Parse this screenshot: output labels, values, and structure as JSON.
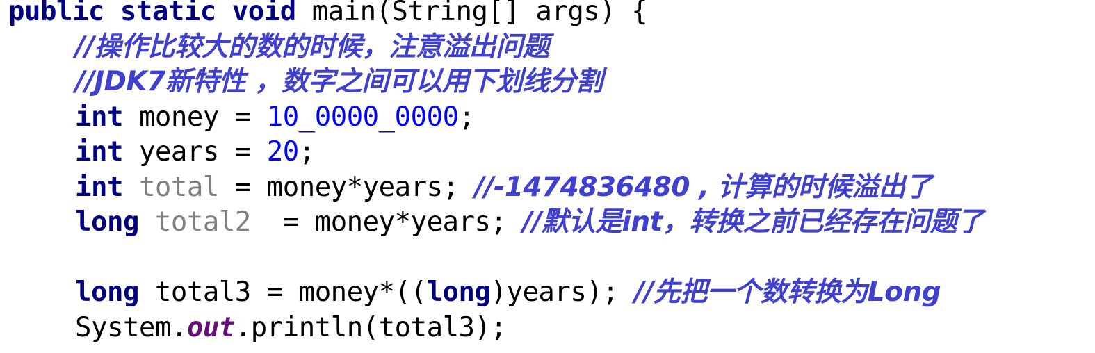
{
  "code": {
    "signature": {
      "kw_public": "public",
      "kw_static": "static",
      "kw_void": "void",
      "rest": "main(String[] args) {"
    },
    "comment1": "//操作比较大的数的时候，注意溢出问题",
    "comment2": "//JDK7新特性 ，数字之间可以用下划线分割",
    "line_money": {
      "type": "int",
      "name": "money",
      "assign": " = ",
      "value": "10_0000_0000",
      "end": ";"
    },
    "line_years": {
      "type": "int",
      "name": "years",
      "assign": " = ",
      "value": "20",
      "end": ";"
    },
    "line_total": {
      "type": "int",
      "name": "total",
      "expr": " = money*years; ",
      "comment": "//-1474836480 , 计算的时候溢出了"
    },
    "line_total2": {
      "type": "long",
      "name": "total2",
      "expr": "  = money*years; ",
      "comment": "//默认是int，转换之前已经存在问题了"
    },
    "line_total3": {
      "type": "long",
      "decl": " total3 = money*((",
      "cast": "long",
      "expr_end": ")years); ",
      "comment": "//先把一个数转换为Long"
    },
    "line_println": {
      "prefix": "System.",
      "field": "out",
      "suffix": ".println(total3);"
    }
  },
  "colors": {
    "keyword": "#000080",
    "number": "#0000ff",
    "comment": "#3f3fd0",
    "unused_variable": "#808080",
    "static_field": "#660e7a"
  }
}
